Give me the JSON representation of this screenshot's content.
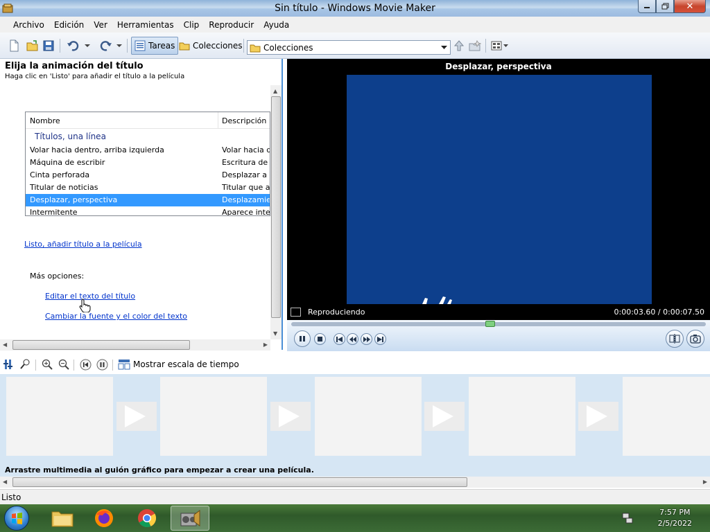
{
  "window": {
    "title": "Sin título - Windows Movie Maker",
    "close_glyph": "✕"
  },
  "menu": [
    "Archivo",
    "Edición",
    "Ver",
    "Herramientas",
    "Clip",
    "Reproducir",
    "Ayuda"
  ],
  "toolbar": {
    "tasks_label": "Tareas",
    "collections_label": "Colecciones",
    "combo_value": "Colecciones"
  },
  "task_pane": {
    "heading": "Elija la animación del título",
    "subtitle": "Haga clic en 'Listo' para añadir el título a la película",
    "list": {
      "headers": [
        "Nombre",
        "Descripción"
      ],
      "group": "Títulos, una línea",
      "rows": [
        {
          "name": "Volar hacia dentro, arriba izquierda",
          "desc": "Volar hacia dentro"
        },
        {
          "name": "Máquina de escribir",
          "desc": "Escritura de te"
        },
        {
          "name": "Cinta perforada",
          "desc": "Desplazar a la"
        },
        {
          "name": "Titular de noticias",
          "desc": "Titular que apa"
        },
        {
          "name": "Desplazar, perspectiva",
          "desc": "Desplazamient",
          "selected": true
        },
        {
          "name": "Intermitente",
          "desc": "Aparece intern"
        }
      ]
    },
    "done_link": "Listo, añadir título a la película",
    "more_options": "Más opciones:",
    "edit_text_link": "Editar el texto del título",
    "font_color_link": "Cambiar la fuente y el color del texto"
  },
  "monitor": {
    "title": "Desplazar, perspectiva",
    "status": "Reproduciendo",
    "time": "0:00:03.60 / 0:00:07.50",
    "seek_position": 0.48
  },
  "storyboard": {
    "timeline_label": "Mostrar escala de tiempo",
    "hint": "Arrastre multimedia al guión gráfico para empezar a crear una película."
  },
  "status_bar": {
    "text": "Listo"
  },
  "taskbar": {
    "time": "7:57 PM",
    "date": "2/5/2022"
  },
  "colors": {
    "selection": "#3399ff",
    "link": "#0033cc",
    "video_bg": "#0d3f8c",
    "accent": "#4a8fd6"
  }
}
